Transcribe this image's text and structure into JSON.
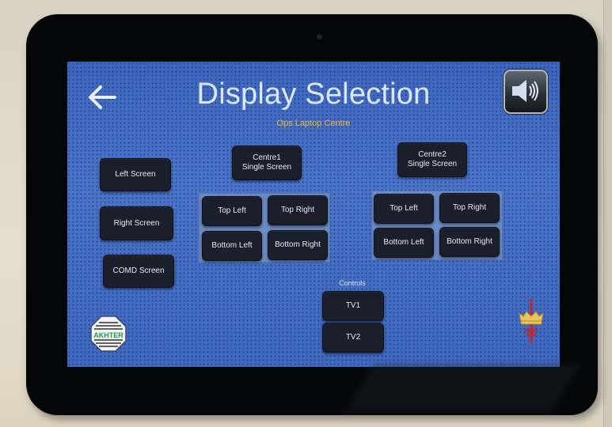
{
  "header": {
    "title": "Display Selection",
    "subtitle": "Ops Laptop Centre",
    "back_icon": "arrow-left-icon",
    "volume_icon": "speaker-volume-icon"
  },
  "screens": {
    "left": "Left Screen",
    "right": "Right Screen",
    "comd": "COMD Screen"
  },
  "centre1": {
    "single": "Centre1\nSingle Screen",
    "quads": [
      "Top Left",
      "Top Right",
      "Bottom Left",
      "Bottom Right"
    ]
  },
  "centre2": {
    "single": "Centre2\nSingle Screen",
    "quads": [
      "Top Left",
      "Top Right",
      "Bottom Left",
      "Bottom Right"
    ]
  },
  "controls": {
    "label": "Controls",
    "tv1": "TV1",
    "tv2": "TV2"
  },
  "logos": {
    "left": "AKHTER",
    "right": "crown-cross-crest"
  },
  "colors": {
    "accent": "#f0b533",
    "background": "#3c63b8",
    "button": "#1b1f2c",
    "logo_green": "#1e9a4a",
    "crest_red": "#c8262f",
    "crest_gold": "#e8c35a"
  }
}
